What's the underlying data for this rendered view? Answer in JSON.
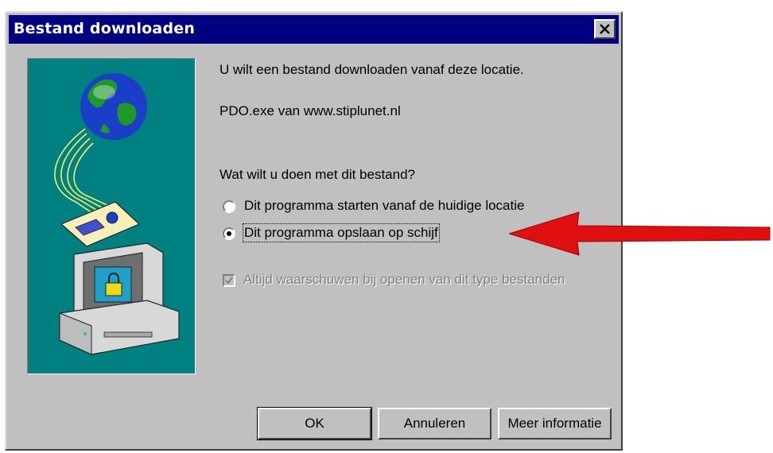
{
  "dialog": {
    "title": "Bestand downloaden",
    "close_glyph": "✕",
    "message_line1": "U wilt een bestand downloaden vanaf deze locatie.",
    "file_line": "PDO.exe van www.stiplunet.nl",
    "question": "Wat wilt u doen met dit bestand?",
    "options": [
      {
        "label": "Dit programma starten vanaf de huidige locatie",
        "selected": false
      },
      {
        "label": "Dit programma opslaan op schijf",
        "selected": true
      }
    ],
    "checkbox": {
      "label": "Altijd waarschuwen bij openen van dit type bestanden",
      "checked": true,
      "disabled": true
    },
    "buttons": {
      "ok": "OK",
      "cancel": "Annuleren",
      "info": "Meer informatie"
    },
    "icons": [
      "globe-icon",
      "computer-lock-icon",
      "close-icon",
      "red-arrow-icon"
    ],
    "colors": {
      "titlebar": "#000080",
      "face": "#c0c0c0",
      "illustration_bg": "#008080",
      "arrow": "#e01010"
    }
  }
}
